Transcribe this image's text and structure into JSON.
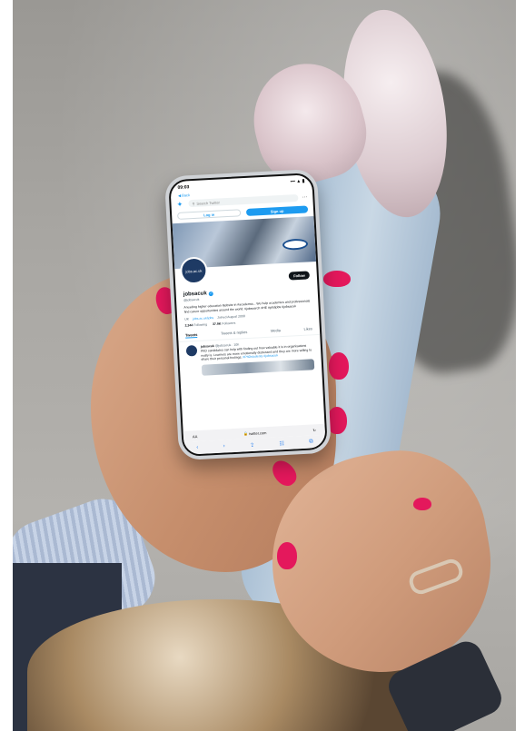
{
  "status_bar": {
    "time": "09:03",
    "signal": "••• ▲ ▮"
  },
  "back_label": "◀ Back",
  "twitter_header": {
    "search_placeholder": "Search Twitter",
    "more": "···",
    "login": "Log in",
    "signup": "Sign up"
  },
  "profile": {
    "avatar_text": "jobs.ac.uk",
    "name": "jobsacuk",
    "verified": "✓",
    "handle": "@jobsacuk",
    "follow": "Follow",
    "bio": "A leading higher education #jobsite in #academia... We help academics and professionals find career opportunities around the world. #jobsearch #HE #phdjobs #jobsacuk",
    "location": "UK",
    "website": "jobs.ac.uk/jobs",
    "joined": "Joined August 2008",
    "following_count": "2,344",
    "following_label": "Following",
    "followers_count": "37.9K",
    "followers_label": "Followers"
  },
  "tabs": [
    "Tweets",
    "Tweets & replies",
    "Media",
    "Likes"
  ],
  "tweet": {
    "author": "jobsacuk",
    "meta": "@jobsacuk · 10h",
    "text": "PhD candidates can help with finding out how valuable it is in organisations really is. Learners are more emotionally distressed and they are more willing to share their personal feelings.",
    "tags": "#PhDstudents #jobsacuk"
  },
  "url_bar": {
    "aa": "AA",
    "host": "🔒 twitter.com",
    "reload": "↻"
  },
  "safari_toolbar": [
    "‹",
    "›",
    "⇪",
    "☷",
    "⧉"
  ]
}
